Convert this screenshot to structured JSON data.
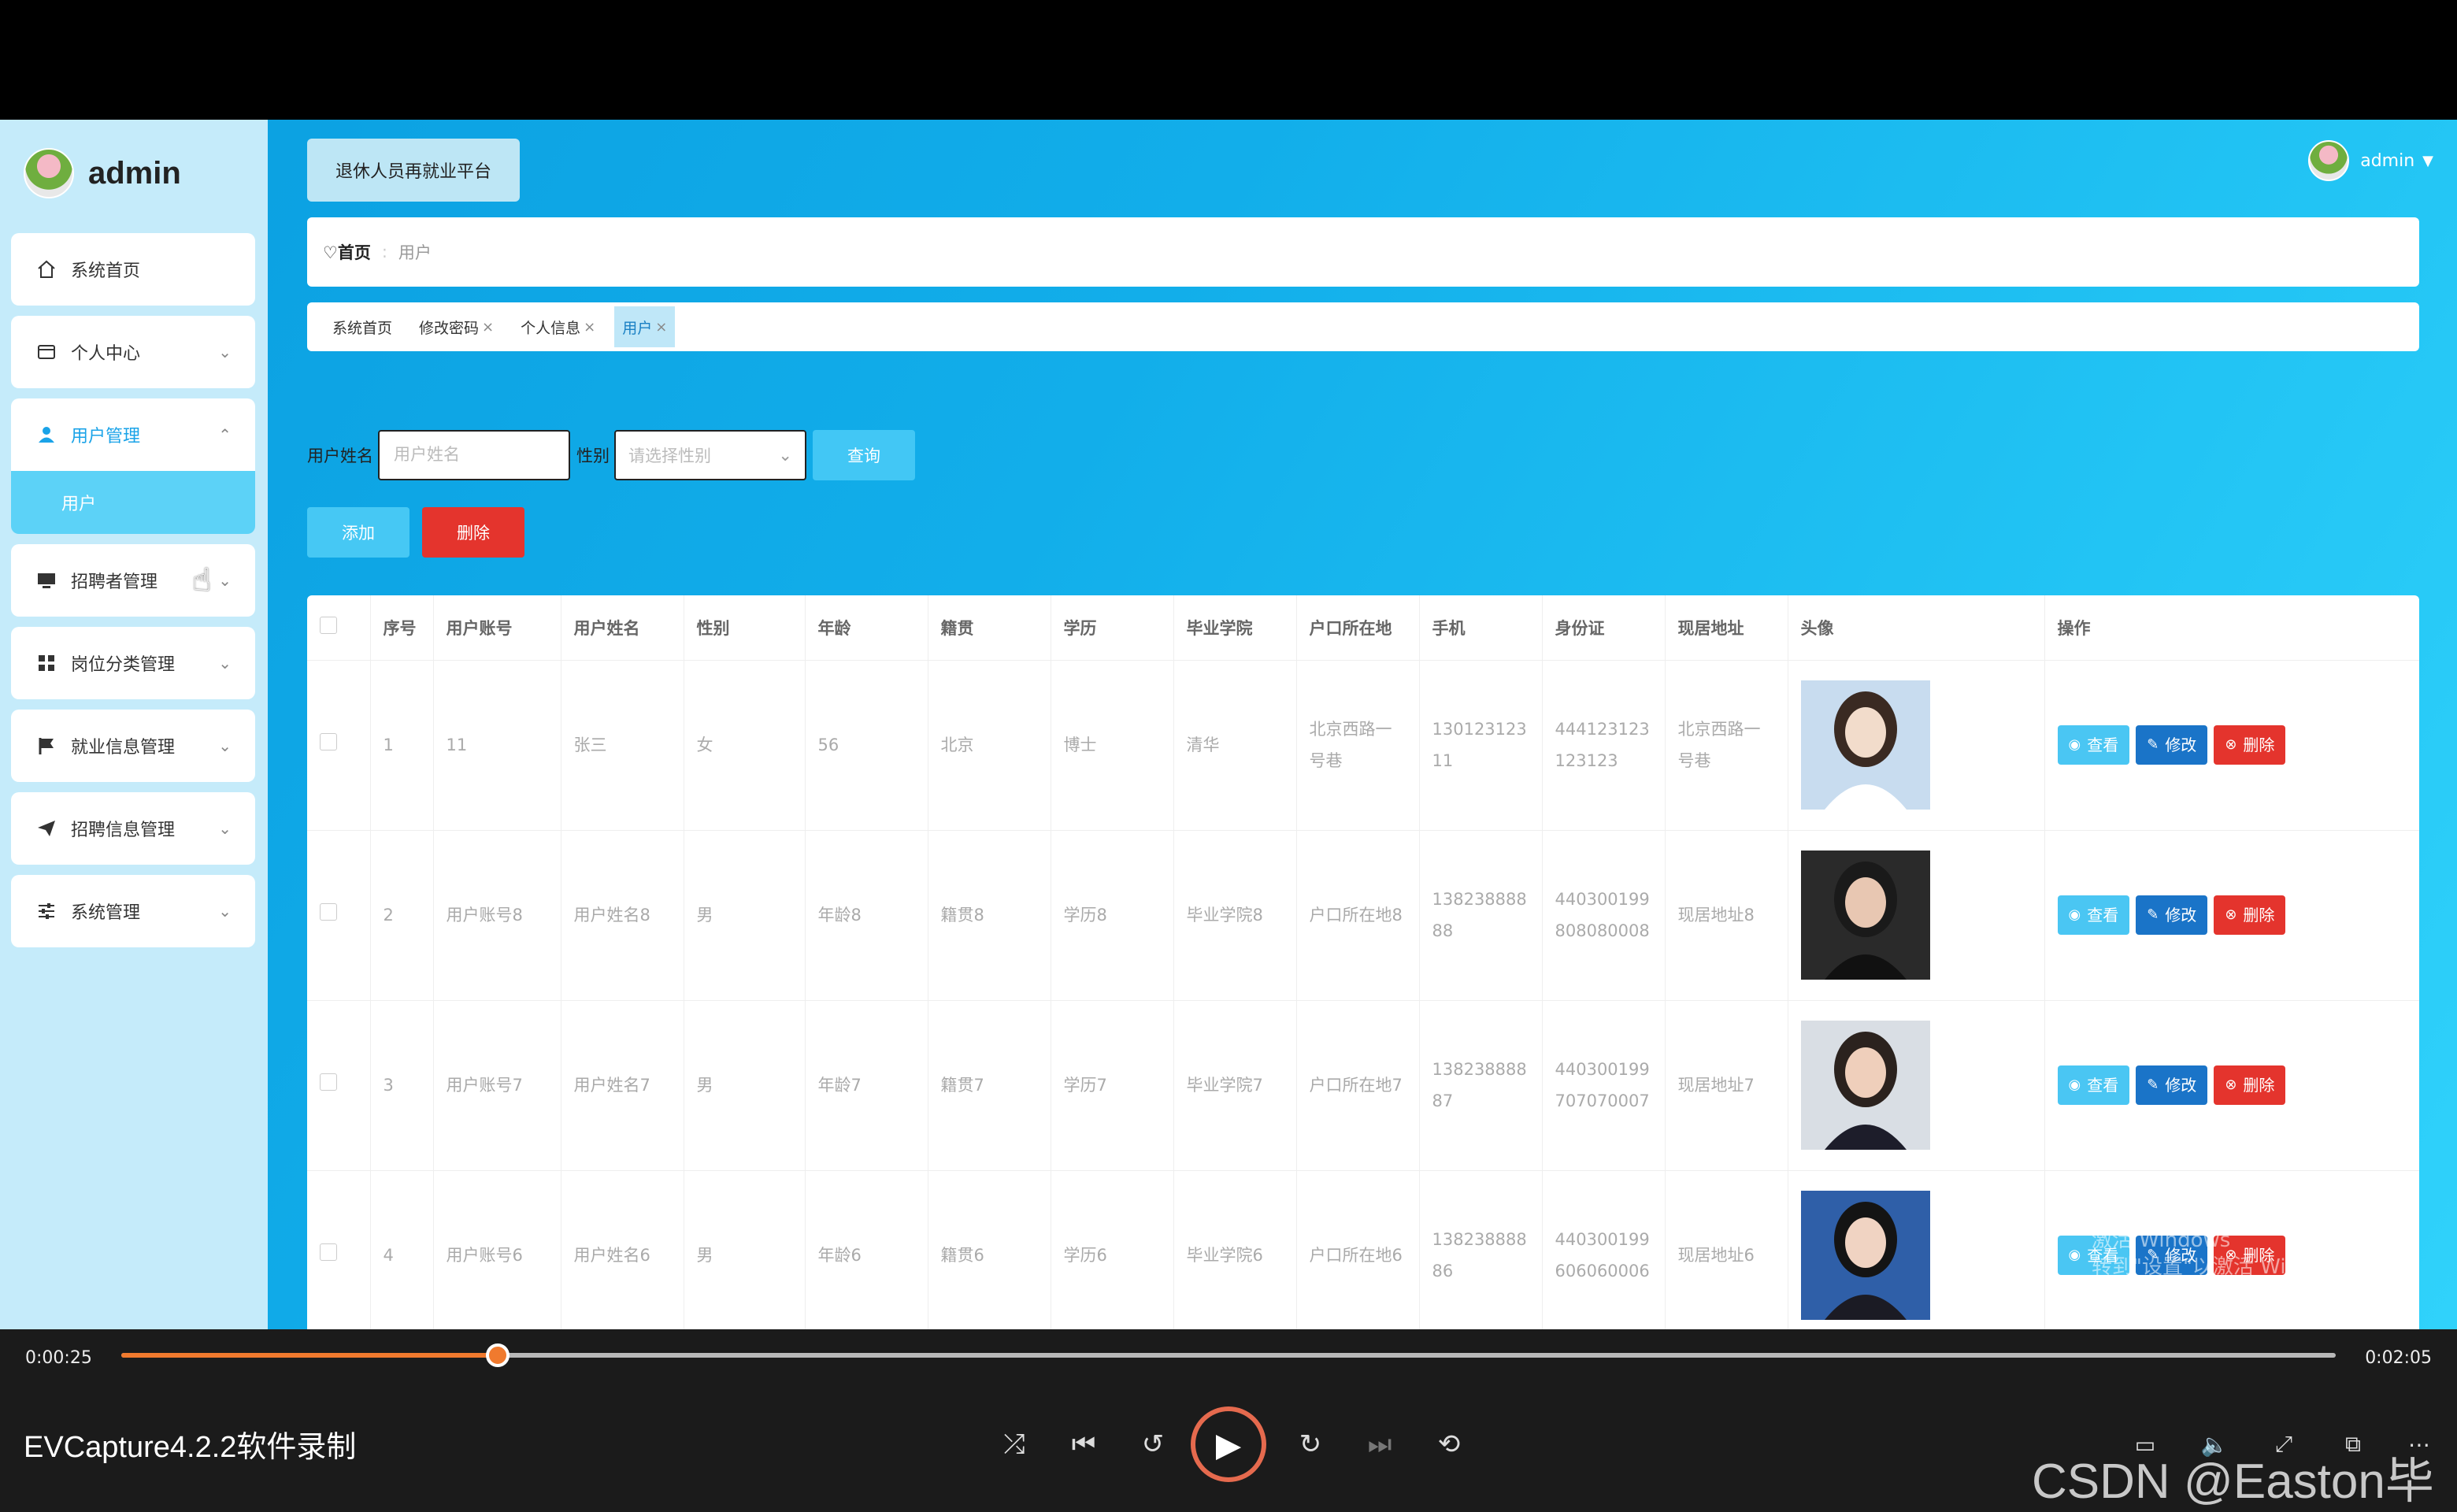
{
  "sidebar": {
    "brand": "admin",
    "menu": [
      {
        "label": "系统首页",
        "icon": "home-icon"
      },
      {
        "label": "个人中心",
        "icon": "card-icon"
      },
      {
        "label": "用户管理",
        "icon": "user-icon"
      },
      {
        "label": "招聘者管理",
        "icon": "monitor-icon"
      },
      {
        "label": "岗位分类管理",
        "icon": "grid-icon"
      },
      {
        "label": "就业信息管理",
        "icon": "flag-icon"
      },
      {
        "label": "招聘信息管理",
        "icon": "send-icon"
      },
      {
        "label": "系统管理",
        "icon": "sliders-icon"
      }
    ],
    "submenu_label": "用户"
  },
  "header": {
    "platform": "退休人员再就业平台",
    "username": "admin"
  },
  "breadcrumb": {
    "home": "首页",
    "current": "用户"
  },
  "tags": [
    {
      "label": "系统首页",
      "closable": false
    },
    {
      "label": "修改密码",
      "closable": true
    },
    {
      "label": "个人信息",
      "closable": true
    },
    {
      "label": "用户",
      "closable": true
    }
  ],
  "search": {
    "name_label": "用户姓名",
    "name_placeholder": "用户姓名",
    "gender_label": "性别",
    "gender_placeholder": "请选择性别",
    "query_label": "查询",
    "add_label": "添加",
    "delete_label": "删除"
  },
  "table": {
    "headers": [
      "序号",
      "用户账号",
      "用户姓名",
      "性别",
      "年龄",
      "籍贯",
      "学历",
      "毕业学院",
      "户口所在地",
      "手机",
      "身份证",
      "现居地址",
      "头像",
      "操作"
    ],
    "rows": [
      [
        "1",
        "11",
        "张三",
        "女",
        "56",
        "北京",
        "博士",
        "清华",
        "北京西路一号巷",
        "13012312311",
        "444123123123123",
        "北京西路一号巷"
      ],
      [
        "2",
        "用户账号8",
        "用户姓名8",
        "男",
        "年龄8",
        "籍贯8",
        "学历8",
        "毕业学院8",
        "户口所在地8",
        "13823888888",
        "440300199808080008",
        "现居地址8"
      ],
      [
        "3",
        "用户账号7",
        "用户姓名7",
        "男",
        "年龄7",
        "籍贯7",
        "学历7",
        "毕业学院7",
        "户口所在地7",
        "13823888887",
        "440300199707070007",
        "现居地址7"
      ],
      [
        "4",
        "用户账号6",
        "用户姓名6",
        "男",
        "年龄6",
        "籍贯6",
        "学历6",
        "毕业学院6",
        "户口所在地6",
        "13823888886",
        "440300199606060006",
        "现居地址6"
      ]
    ],
    "actions": {
      "view": "查看",
      "edit": "修改",
      "delete": "删除"
    }
  },
  "watermark": {
    "line1": "激活 Windows",
    "line2": "转到\"设置\"以激活 Windows。"
  },
  "player": {
    "current_time": "0:00:25",
    "total_time": "0:02:05",
    "progress": 0.17,
    "title": "EVCapture4.2.2软件录制",
    "csdn_tag": "CSDN @Easton毕设"
  },
  "colors": {
    "accent": "#1aa3e8",
    "danger": "#e4342d",
    "progress": "#f07a2e"
  }
}
